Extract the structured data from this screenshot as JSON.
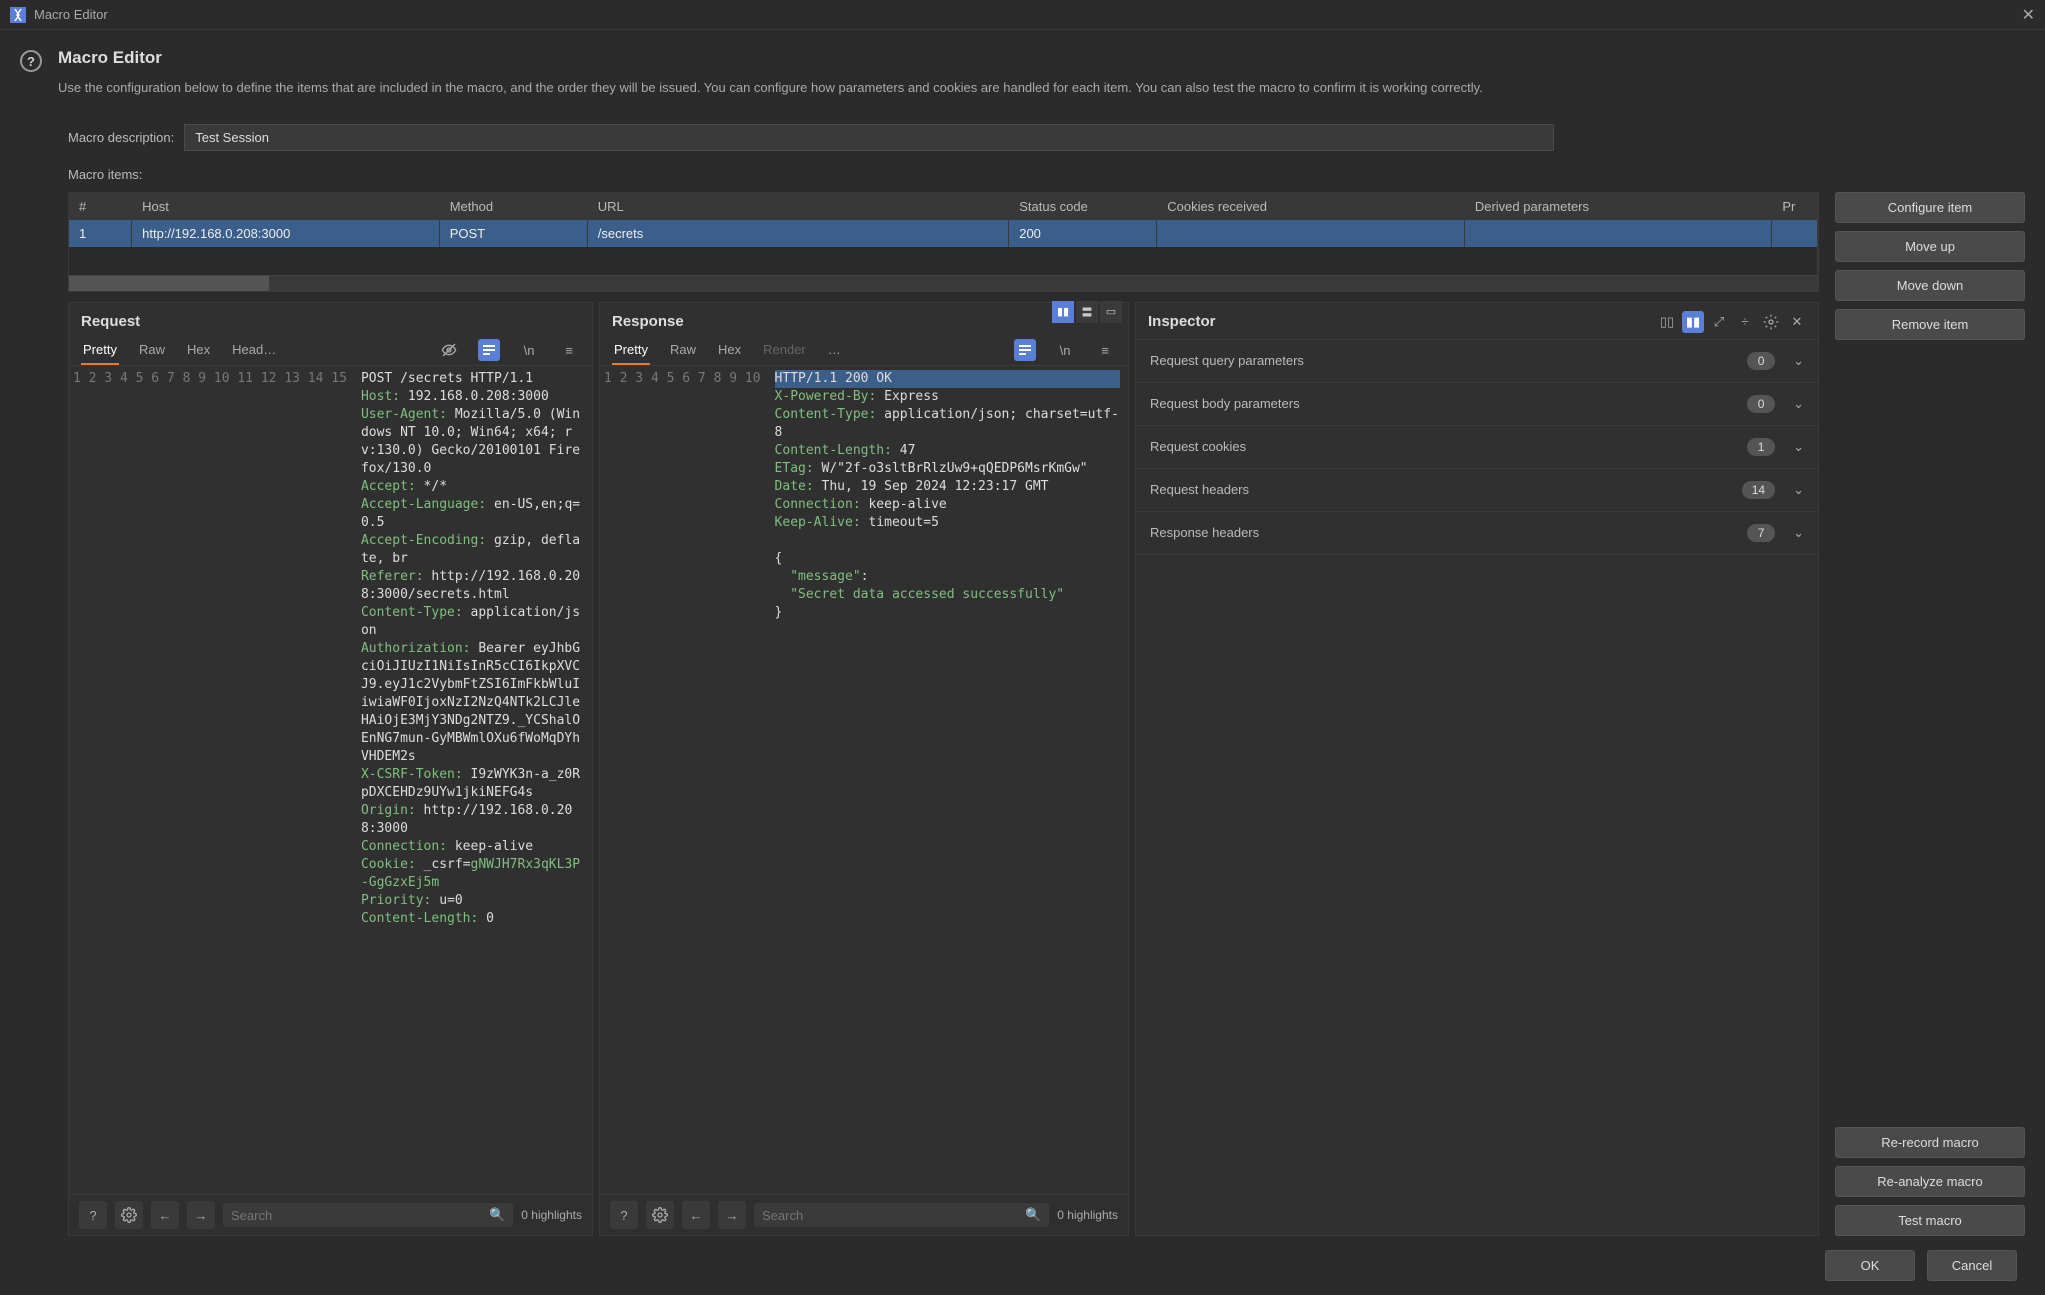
{
  "window": {
    "title": "Macro Editor"
  },
  "header": {
    "title": "Macro Editor",
    "description": "Use the configuration below to define the items that are included in the macro, and the order they will be issued. You can configure how parameters and cookies are handled for each item. You can also test the macro to confirm it is working correctly."
  },
  "form": {
    "description_label": "Macro description:",
    "description_value": "Test Session",
    "items_label": "Macro items:"
  },
  "table": {
    "headers": [
      "#",
      "Host",
      "Method",
      "URL",
      "Status code",
      "Cookies received",
      "Derived parameters",
      "Pr"
    ],
    "rows": [
      {
        "num": "1",
        "host": "http://192.168.0.208:3000",
        "method": "POST",
        "url": "/secrets",
        "status": "200",
        "cookies": "",
        "derived": "",
        "pr": ""
      }
    ]
  },
  "side_buttons_top": {
    "configure": "Configure item",
    "move_up": "Move up",
    "move_down": "Move down",
    "remove": "Remove item"
  },
  "side_buttons_bottom": {
    "rerecord": "Re-record macro",
    "reanalyze": "Re-analyze macro",
    "test": "Test macro"
  },
  "request": {
    "title": "Request",
    "tabs": [
      "Pretty",
      "Raw",
      "Hex",
      "Head…"
    ],
    "lines": [
      {
        "n": "1",
        "raw": "POST /secrets HTTP/1.1"
      },
      {
        "n": "2",
        "k": "Host:",
        "v": " 192.168.0.208:3000"
      },
      {
        "n": "3",
        "k": "User-Agent:",
        "v": " Mozilla/5.0 (Windows NT 10.0; Win64; x64; rv:130.0) Gecko/20100101 Firefox/130.0"
      },
      {
        "n": "4",
        "k": "Accept:",
        "v": " */*"
      },
      {
        "n": "5",
        "k": "Accept-Language:",
        "v": " en-US,en;q=0.5"
      },
      {
        "n": "6",
        "k": "Accept-Encoding:",
        "v": " gzip, deflate, br"
      },
      {
        "n": "7",
        "k": "Referer:",
        "v": " http://192.168.0.208:3000/secrets.html"
      },
      {
        "n": "8",
        "k": "Content-Type:",
        "v": " application/json"
      },
      {
        "n": "9",
        "k": "Authorization:",
        "v": " Bearer eyJhbGciOiJIUzI1NiIsInR5cCI6IkpXVCJ9.eyJ1c2VybmFtZSI6ImFkbWluIiwiaWF0IjoxNzI2NzQ4NTk2LCJleHAiOjE3MjY3NDg2NTZ9._YCShalOEnNG7mun-GyMBWmlOXu6fWoMqDYhVHDEM2s"
      },
      {
        "n": "10",
        "k": "X-CSRF-Token:",
        "v": " I9zWYK3n-a_z0RpDXCEHDz9UYw1jkiNEFG4s"
      },
      {
        "n": "11",
        "k": "Origin:",
        "v": " http://192.168.0.208:3000"
      },
      {
        "n": "12",
        "k": "Connection:",
        "v": " keep-alive"
      },
      {
        "n": "13",
        "k": "Cookie:",
        "v": " _csrf=",
        "cookie": "gNWJH7Rx3qKL3P-GgGzxEj5m"
      },
      {
        "n": "14",
        "k": "Priority:",
        "v": " u=0"
      },
      {
        "n": "15",
        "k": "Content-Length:",
        "v": " 0"
      }
    ],
    "search_placeholder": "Search",
    "highlights": "0 highlights"
  },
  "response": {
    "title": "Response",
    "tabs": [
      "Pretty",
      "Raw",
      "Hex",
      "Render",
      "…"
    ],
    "lines": [
      {
        "n": "1",
        "raw": "HTTP/1.1 200 OK",
        "hl": true
      },
      {
        "n": "2",
        "k": "X-Powered-By:",
        "v": " Express"
      },
      {
        "n": "3",
        "k": "Content-Type:",
        "v": " application/json; charset=utf-8"
      },
      {
        "n": "4",
        "k": "Content-Length:",
        "v": " 47"
      },
      {
        "n": "5",
        "k": "ETag:",
        "v": " W/\"2f-o3sltBrRlzUw9+qQEDP6MsrKmGw\""
      },
      {
        "n": "6",
        "k": "Date:",
        "v": " Thu, 19 Sep 2024 12:23:17 GMT"
      },
      {
        "n": "7",
        "k": "Connection:",
        "v": " keep-alive"
      },
      {
        "n": "8",
        "k": "Keep-Alive:",
        "v": " timeout=5"
      },
      {
        "n": "9",
        "raw": ""
      },
      {
        "n": "10",
        "json": "{\n  \"message\":\n  \"Secret data accessed successfully\"\n}"
      }
    ],
    "search_placeholder": "Search",
    "highlights": "0 highlights"
  },
  "inspector": {
    "title": "Inspector",
    "rows": [
      {
        "label": "Request query parameters",
        "count": "0"
      },
      {
        "label": "Request body parameters",
        "count": "0"
      },
      {
        "label": "Request cookies",
        "count": "1"
      },
      {
        "label": "Request headers",
        "count": "14"
      },
      {
        "label": "Response headers",
        "count": "7"
      }
    ]
  },
  "footer_buttons": {
    "ok": "OK",
    "cancel": "Cancel"
  }
}
